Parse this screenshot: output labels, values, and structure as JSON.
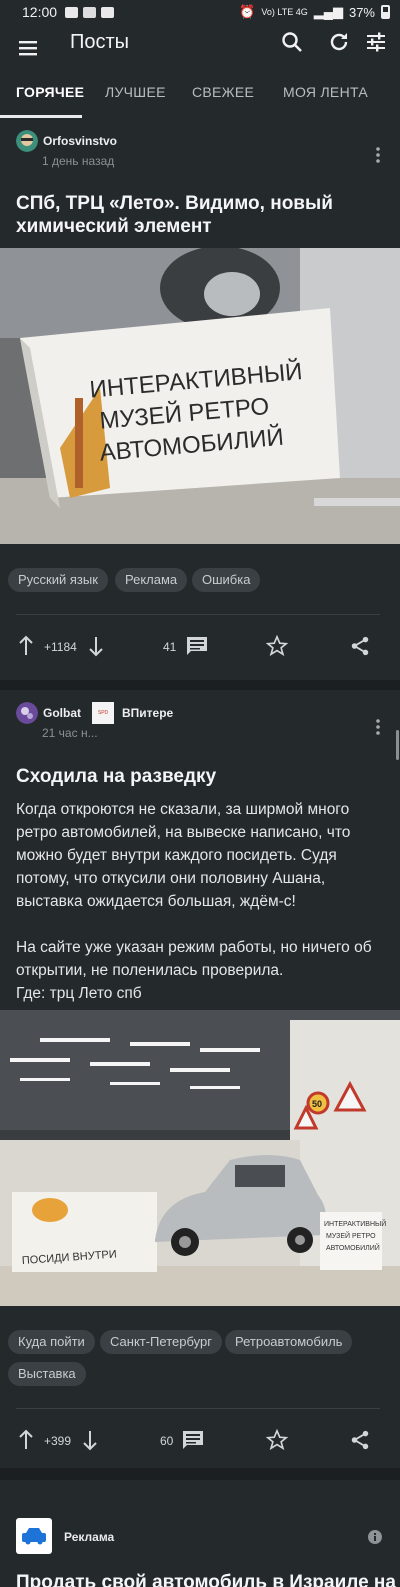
{
  "status_bar": {
    "time": "12:00",
    "network": "Vo) LTE 4G",
    "battery": "37%"
  },
  "app_bar": {
    "title": "Посты"
  },
  "tabs": [
    {
      "label": "ГОРЯЧЕЕ",
      "active": true
    },
    {
      "label": "ЛУЧШЕЕ",
      "active": false
    },
    {
      "label": "СВЕЖЕЕ",
      "active": false
    },
    {
      "label": "МОЯ ЛЕНТА",
      "active": false
    }
  ],
  "posts": [
    {
      "author": "Orfosvinstvo",
      "time": "1 день назад",
      "title_lines": [
        "СПб, ТРЦ «Лето». Видимо, новый",
        "химический элемент"
      ],
      "image": {
        "sign_lines": [
          "ИНТЕРАКТИВНЫЙ",
          "МУЗЕЙ РЕТРО",
          "АВТОМОБИЛИЙ"
        ]
      },
      "tags": [
        "Русский язык",
        "Реклама",
        "Ошибка"
      ],
      "rating": "+1184",
      "comments": "41"
    },
    {
      "author": "Golbat",
      "community": "ВПитере",
      "community_badge": "SPD",
      "time": "21 час н...",
      "title": "Сходила на разведку",
      "body_lines": [
        "Когда откроются не сказали, за ширмой много",
        "ретро автомобилей, на вывеске написано, что",
        "можно будет внутри каждого посидеть. Судя",
        "потому, что откусили они половину Ашана,",
        "выставка ожидается большая, ждём-с!",
        "",
        "На сайте уже указан режим работы, но ничего об",
        "открытии, не поленилась проверила.",
        "Где: трц Лето спб"
      ],
      "image": {
        "banner_text": "ПОСИДИ ВНУТРИ",
        "sign_lines": [
          "ИНТЕРАКТИВНЫЙ",
          "МУЗЕЙ РЕТРО",
          "АВТОМОБИЛИЙ"
        ],
        "road_sign": "50"
      },
      "tags": [
        "Куда пойти",
        "Санкт-Петербург",
        "Ретроавтомобиль",
        "Выставка"
      ],
      "rating": "+399",
      "comments": "60"
    }
  ],
  "ad": {
    "label": "Реклама",
    "title": "Продать свой автомобиль в Израиле на"
  },
  "colors": {
    "background": "#1b1f22",
    "card": "#24292c",
    "tag": "#3a4044",
    "text": "#e8eaeb"
  }
}
